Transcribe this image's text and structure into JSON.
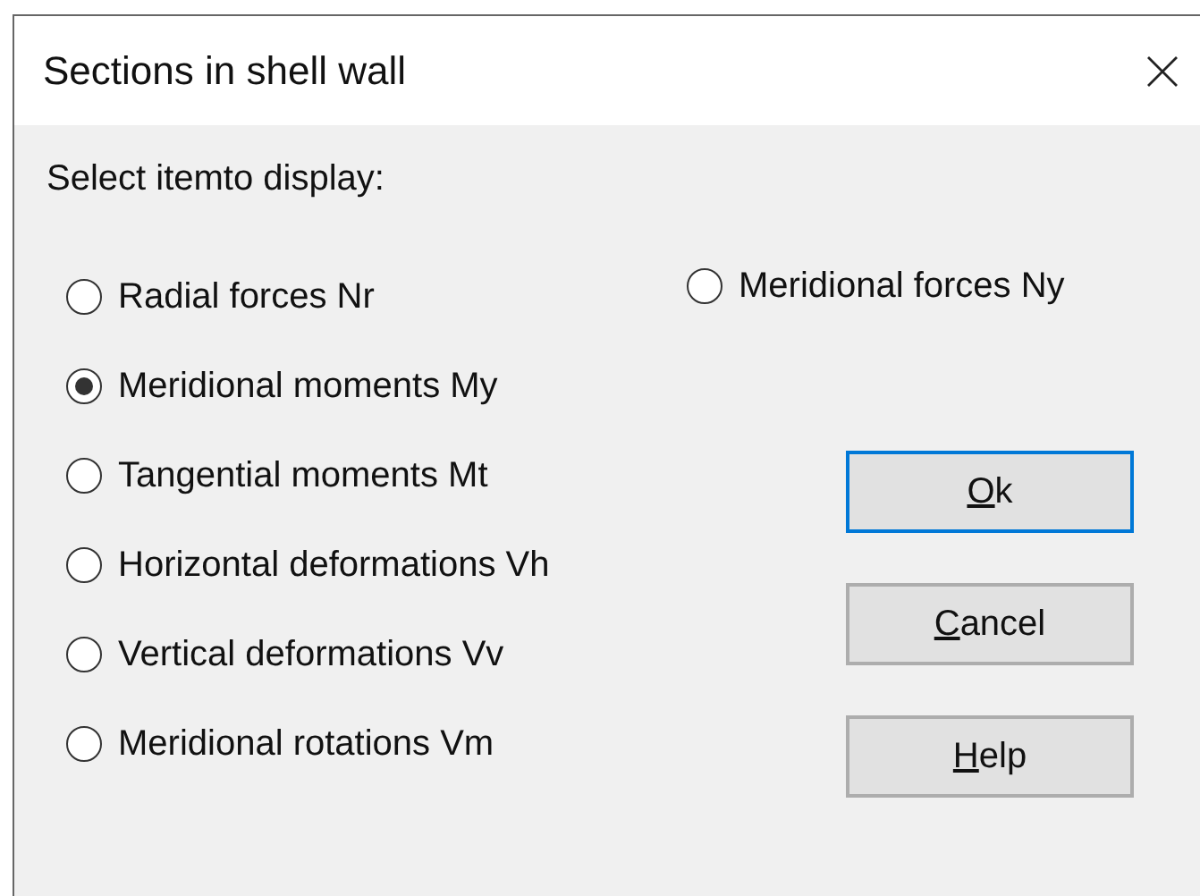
{
  "window": {
    "title": "Sections in shell wall"
  },
  "prompt": "Select itemto display:",
  "options_left": [
    {
      "label": "Radial forces Nr",
      "selected": false
    },
    {
      "label": "Meridional moments My",
      "selected": true
    },
    {
      "label": "Tangential moments Mt",
      "selected": false
    },
    {
      "label": "Horizontal deformations Vh",
      "selected": false
    },
    {
      "label": "Vertical deformations Vv",
      "selected": false
    },
    {
      "label": "Meridional rotations Vm",
      "selected": false
    }
  ],
  "options_right": [
    {
      "label": "Meridional forces Ny",
      "selected": false
    }
  ],
  "buttons": [
    {
      "underlined": "O",
      "rest": "k",
      "default": true
    },
    {
      "underlined": "C",
      "rest": "ancel",
      "default": false
    },
    {
      "underlined": "H",
      "rest": "elp",
      "default": false
    }
  ]
}
